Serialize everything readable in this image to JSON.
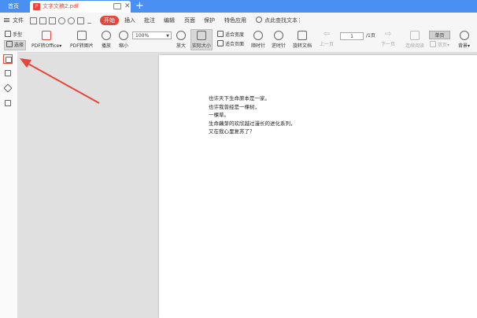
{
  "tabs": {
    "home_label": "首页",
    "doc_label": "文字文稿2.pdf",
    "add_label": "+",
    "close_glyph": "✕"
  },
  "menu": {
    "file_label": "文件",
    "items": [
      "开始",
      "插入",
      "批注",
      "编辑",
      "页面",
      "保护",
      "特色应用"
    ],
    "search_placeholder": "点此查找文本",
    "more_glyph": "⋮"
  },
  "ribbon": {
    "hand": "手型",
    "select": "选择",
    "pdf_to_office": "PDF转Office",
    "pdf_to_image": "PDF转图片",
    "play": "播放",
    "zoom_out": "缩小",
    "zoom_value": "100%",
    "zoom_in": "放大",
    "actual_size": "实际大小",
    "fit_width": "适合宽度",
    "fit_page": "适合页面",
    "rotate_cw": "顺时针",
    "rotate_ccw": "逆时针",
    "rotate_doc": "旋转文档",
    "prev_page": "上一页",
    "page_current": "1",
    "page_total": "/1页",
    "next_page": "下一页",
    "continuous": "连续阅读",
    "double": "双页",
    "single": "单页",
    "background": "背景"
  },
  "document": {
    "lines": [
      "也许天下生命原本是一家。",
      "也许我曾经是一棵树，",
      "一棵草。",
      "生命藕芽的欢欣越过漫长的进化系列，",
      "又在我心里复苏了？"
    ]
  },
  "colors": {
    "tabbar": "#4a8ff2",
    "accent": "#e8453c",
    "workspace": "#e0e0e0"
  }
}
